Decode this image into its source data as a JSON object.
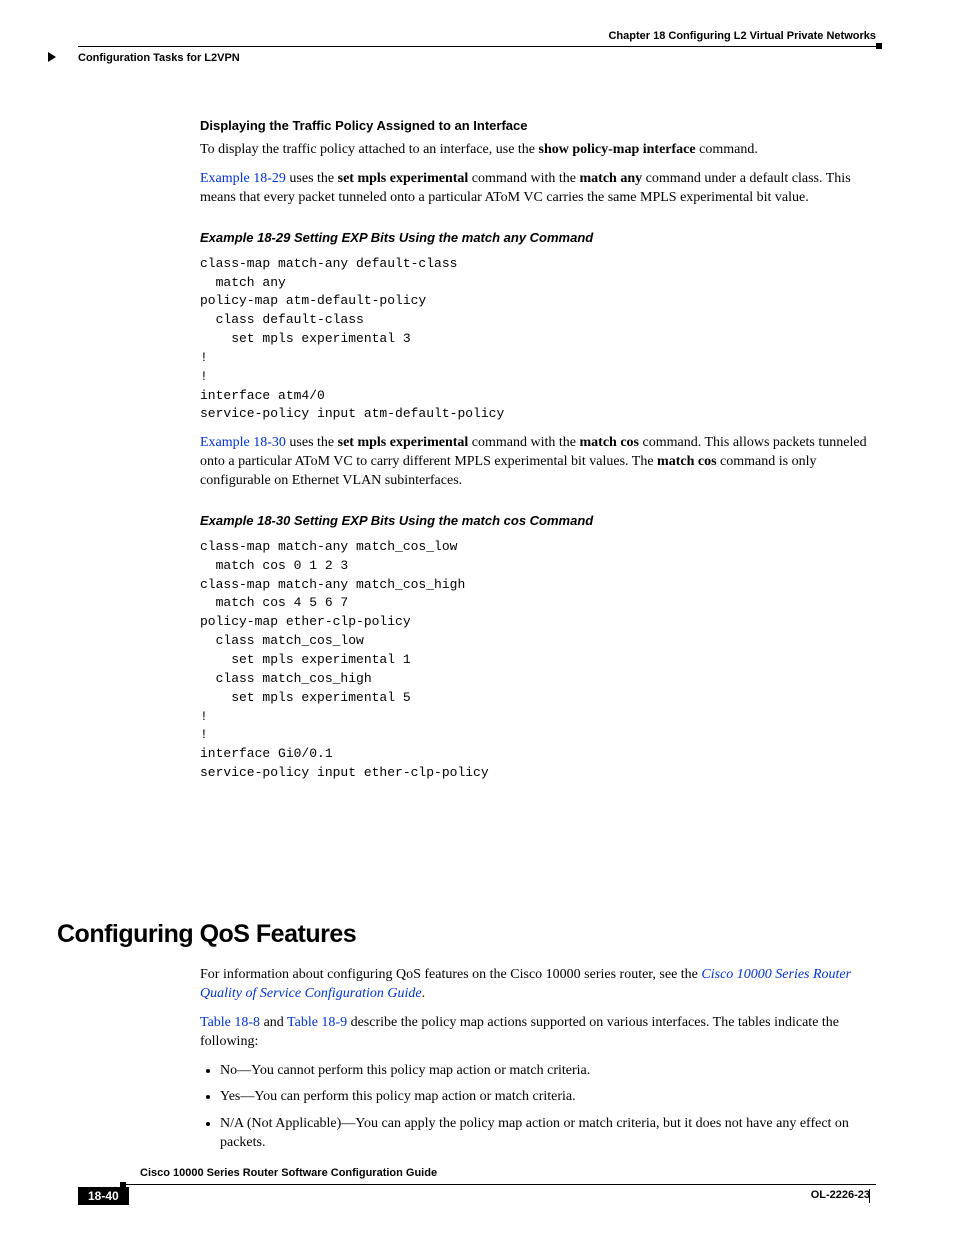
{
  "header": {
    "chapter": "Chapter 18    Configuring L2 Virtual Private Networks",
    "section": "Configuration Tasks for L2VPN"
  },
  "s1_title": "Displaying the Traffic Policy Assigned to an Interface",
  "p1_a": "To display the traffic policy attached to an interface, use the ",
  "p1_b": "show policy-map interface",
  "p1_c": " command.",
  "p2_link": "Example 18-29",
  "p2_a": " uses the ",
  "p2_b": "set mpls experimental",
  "p2_c": " command with the ",
  "p2_d": "match any",
  "p2_e": " command under a default class. This means that every packet tunneled onto a particular AToM VC carries the same MPLS experimental bit value.",
  "ex29_title": "Example 18-29 Setting EXP Bits Using the match any Command",
  "code29": "class-map match-any default-class\n  match any\npolicy-map atm-default-policy\n  class default-class\n    set mpls experimental 3\n!\n!\ninterface atm4/0\nservice-policy input atm-default-policy",
  "p3_link": "Example 18-30",
  "p3_a": " uses the ",
  "p3_b": "set mpls experimental",
  "p3_c": " command with the ",
  "p3_d": "match cos",
  "p3_e": " command. This allows packets tunneled onto a particular AToM VC to carry different MPLS experimental bit values. The ",
  "p3_f": "match cos",
  "p3_g": " command is only configurable on Ethernet VLAN subinterfaces.",
  "ex30_title": "Example 18-30 Setting EXP Bits Using the match cos Command",
  "code30": "class-map match-any match_cos_low\n  match cos 0 1 2 3\nclass-map match-any match_cos_high\n  match cos 4 5 6 7\npolicy-map ether-clp-policy\n  class match_cos_low\n    set mpls experimental 1\n  class match_cos_high\n    set mpls experimental 5\n!\n!\ninterface Gi0/0.1\nservice-policy input ether-clp-policy",
  "h1": "Configuring QoS Features",
  "p4_a": "For information about configuring QoS features on the Cisco 10000 series router, see the ",
  "p4_link": "Cisco 10000 Series Router Quality of Service Configuration Guide",
  "p4_b": ".",
  "p5_link1": "Table 18-8",
  "p5_mid": " and ",
  "p5_link2": "Table 18-9",
  "p5_b": " describe the policy map actions supported on various interfaces. The tables indicate the following:",
  "b1": "No—You cannot perform this policy map action or match criteria.",
  "b2": "Yes—You can perform this policy map action or match criteria.",
  "b3": "N/A (Not Applicable)—You can apply the policy map action or match criteria, but it does not have any effect on packets.",
  "footer": {
    "book": "Cisco 10000 Series Router Software Configuration Guide",
    "page": "18-40",
    "docid": "OL-2226-23"
  }
}
